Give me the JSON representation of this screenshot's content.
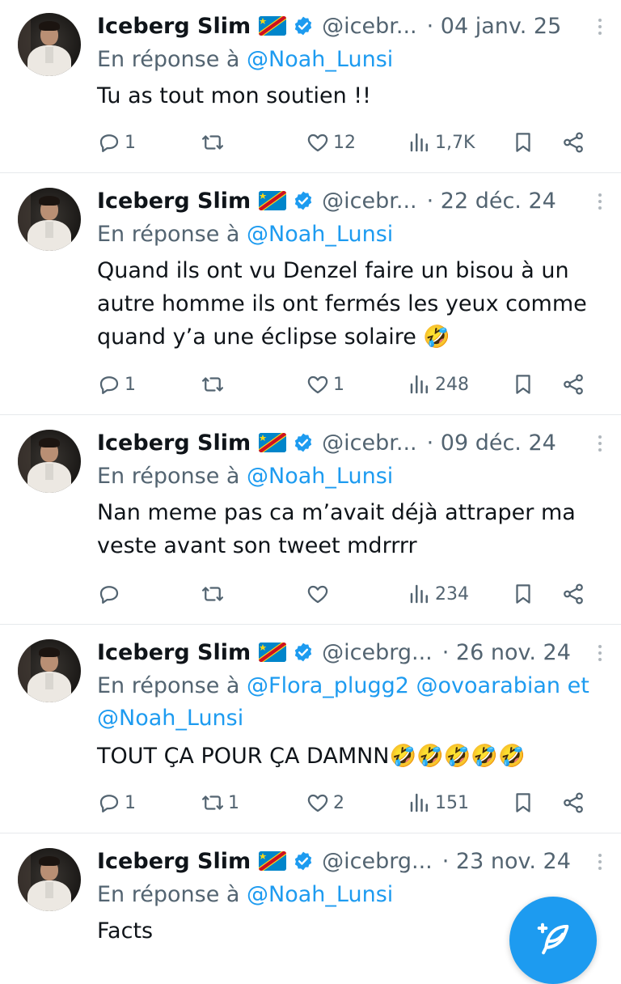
{
  "tweets": [
    {
      "name": "Iceberg Slim",
      "handle": "@icebr...",
      "date": "· 04 janv. 25",
      "reply_prefix": "En réponse à",
      "reply_mentions": "@Noah_Lunsi",
      "text": "Tu as tout mon soutien !!",
      "replies": "1",
      "retweets": "",
      "likes": "12",
      "views": "1,7K"
    },
    {
      "name": "Iceberg Slim",
      "handle": "@icebr...",
      "date": "· 22 déc. 24",
      "reply_prefix": "En réponse à",
      "reply_mentions": "@Noah_Lunsi",
      "text": "Quand ils ont vu Denzel faire un bisou à un autre homme ils ont fermés les yeux comme quand y’a une éclipse solaire 🤣",
      "replies": "1",
      "retweets": "",
      "likes": "1",
      "views": "248"
    },
    {
      "name": "Iceberg Slim",
      "handle": "@icebr...",
      "date": "· 09 déc. 24",
      "reply_prefix": "En réponse à",
      "reply_mentions": "@Noah_Lunsi",
      "text": "Nan meme pas ca m’avait déjà attraper ma veste avant son tweet mdrrrr",
      "replies": "",
      "retweets": "",
      "likes": "",
      "views": "234"
    },
    {
      "name": "Iceberg Slim",
      "handle": "@icebrg...",
      "date": "· 26 nov. 24",
      "reply_prefix": "En réponse à",
      "reply_mentions": "@Flora_plugg2 @ovoarabian et @Noah_Lunsi",
      "text": "TOUT ÇA POUR ÇA DAMNN🤣🤣🤣🤣🤣",
      "replies": "1",
      "retweets": "1",
      "likes": "2",
      "views": "151"
    },
    {
      "name": "Iceberg Slim",
      "handle": "@icebrg...",
      "date": "· 23 nov. 24",
      "reply_prefix": "En réponse à",
      "reply_mentions": "@Noah_Lunsi",
      "text": "Facts",
      "replies": "",
      "retweets": "",
      "likes": "",
      "views": ""
    }
  ],
  "icons": {
    "reply": "reply-icon",
    "retweet": "retweet-icon",
    "like": "heart-icon",
    "views": "views-icon",
    "bookmark": "bookmark-icon",
    "share": "share-icon",
    "compose": "compose-icon"
  },
  "colors": {
    "accent": "#1d9bf0",
    "secondary_text": "#536471",
    "text": "#0f1419"
  }
}
